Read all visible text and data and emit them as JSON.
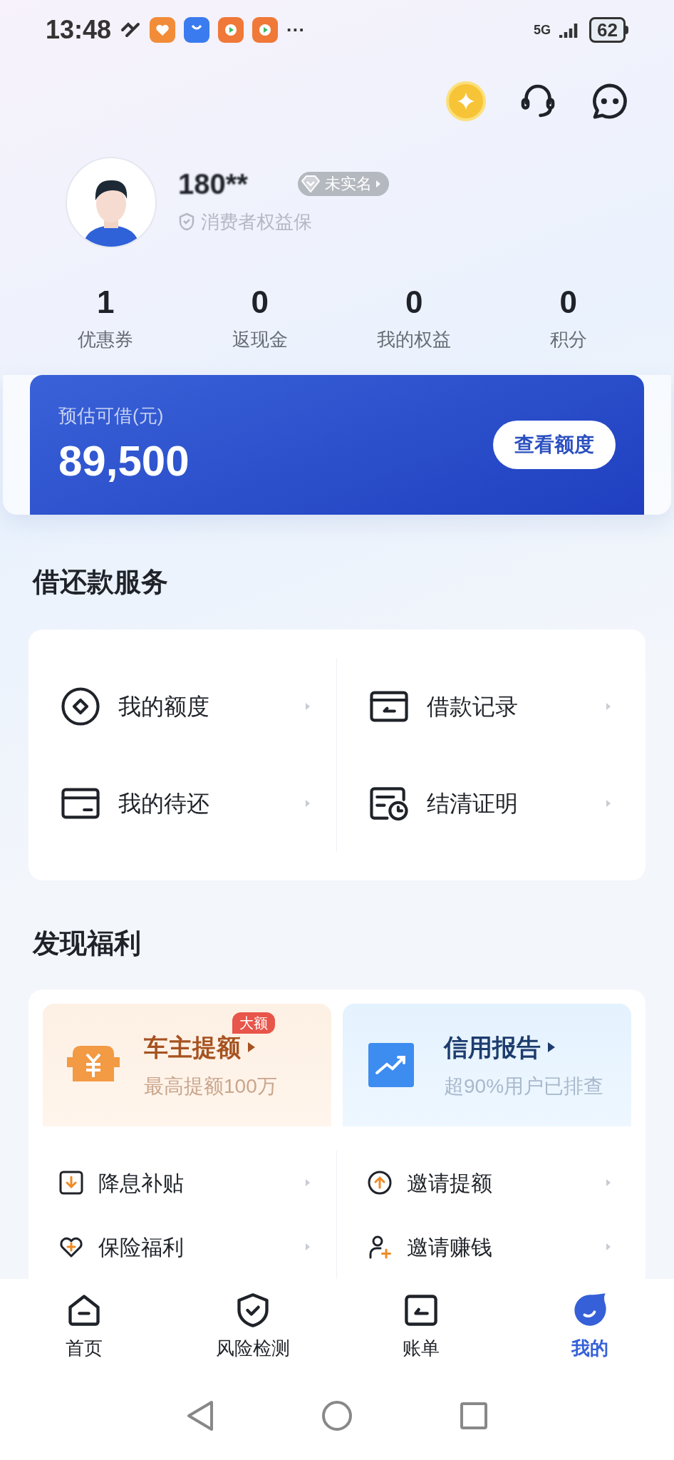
{
  "status_bar": {
    "time": "13:48",
    "more": "···",
    "network": "5G",
    "battery": "62"
  },
  "profile": {
    "name": "180**",
    "badge": "未实名",
    "subtitle": "消费者权益保"
  },
  "stats": [
    {
      "value": "1",
      "label": "优惠券"
    },
    {
      "value": "0",
      "label": "返现金"
    },
    {
      "value": "0",
      "label": "我的权益"
    },
    {
      "value": "0",
      "label": "积分"
    }
  ],
  "credit_card": {
    "label": "预估可借(元)",
    "amount": "89,500",
    "button": "查看额度"
  },
  "loan_services": {
    "title": "借还款服务",
    "items": [
      {
        "label": "我的额度"
      },
      {
        "label": "借款记录"
      },
      {
        "label": "我的待还"
      },
      {
        "label": "结清证明"
      }
    ]
  },
  "welfare": {
    "title": "发现福利",
    "promos": [
      {
        "kind": "orange",
        "title": "车主提额",
        "subtitle": "最高提额100万",
        "tag": "大额"
      },
      {
        "kind": "blue",
        "title": "信用报告",
        "subtitle": "超90%用户已排查"
      }
    ],
    "items": [
      {
        "label": "降息补贴"
      },
      {
        "label": "邀请提额"
      },
      {
        "label": "保险福利"
      },
      {
        "label": "邀请赚钱"
      }
    ]
  },
  "bottom_nav": [
    {
      "label": "首页",
      "selected": false
    },
    {
      "label": "风险检测",
      "selected": false
    },
    {
      "label": "账单",
      "selected": false
    },
    {
      "label": "我的",
      "selected": true
    }
  ]
}
